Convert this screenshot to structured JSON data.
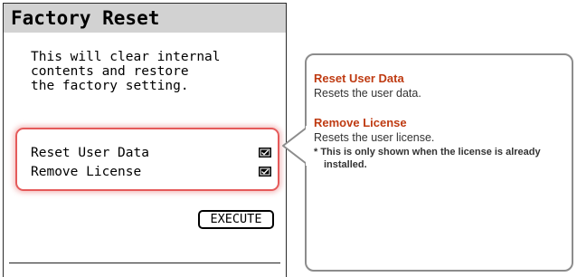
{
  "screen": {
    "title": "Factory Reset",
    "description_lines": [
      "This will clear internal",
      "contents and restore",
      "the factory setting."
    ],
    "options": [
      {
        "label": "Reset User Data",
        "checked": true
      },
      {
        "label": "Remove License",
        "checked": true
      }
    ],
    "execute_label": "EXECUTE",
    "highlight_color": "#e55a5a"
  },
  "callout": {
    "items": [
      {
        "heading": "Reset User Data",
        "body": "Resets the user data."
      },
      {
        "heading": "Remove License",
        "body": "Resets the user license.",
        "note": "* This is only shown when the license is already installed."
      }
    ],
    "heading_color": "#bf3b12",
    "border_color": "#8c8c8c"
  }
}
